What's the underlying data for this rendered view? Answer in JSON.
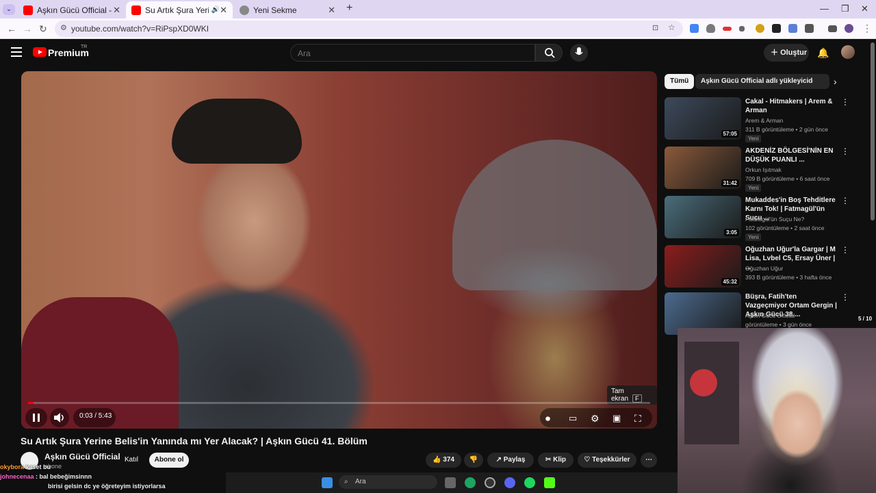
{
  "browser": {
    "tabs": [
      {
        "title": "Aşkın Gücü Official - YouTube"
      },
      {
        "title": "Su Artık Şura Yerine Belis'in"
      },
      {
        "title": "Yeni Sekme"
      }
    ],
    "url": "youtube.com/watch?v=RiPspXD0WKI"
  },
  "youtube": {
    "brand": "Premium",
    "region": "TR",
    "search_placeholder": "Ara",
    "create_label": "Oluştur"
  },
  "video": {
    "tooltip": "Tam ekran",
    "tooltip_key": "F",
    "timecode": "0:03 / 5:43",
    "progress": 0.009,
    "title": "Su Artık Şura Yerine Belis'in Yanında mı Yer Alacak? | Aşkın Gücü 41. Bölüm"
  },
  "channel": {
    "name": "Aşkın Gücü Official",
    "subs": "abone",
    "join_label": "Katıl",
    "subscribe_label": "Abone ol"
  },
  "actions": {
    "likes": "374",
    "share": "Paylaş",
    "clip": "Klip",
    "thanks": "Teşekkürler"
  },
  "chips": [
    "Tümü",
    "Aşkın Gücü Official adlı yükleyiciden"
  ],
  "recommendations": [
    {
      "title": "Cakal - Hitmakers | Arem & Arman",
      "channel": "Arem & Arman",
      "meta": "311 B görüntüleme • 2 gün önce",
      "badge": "Yeni",
      "duration": "57:05",
      "color": "#3d4a5c"
    },
    {
      "title": "AKDENİZ BÖLGESİ'NİN EN DÜŞÜK PUANLI ...",
      "channel": "Orkun Işıtmak",
      "meta": "709 B görüntüleme • 6 saat önce",
      "badge": "Yeni",
      "duration": "31:42",
      "color": "#8a5a3a"
    },
    {
      "title": "Mukaddes'in Boş Tehditlere Karnı Tok! | Fatmagül'ün Suçu ...",
      "channel": "Fatmagül'ün Suçu Ne?",
      "meta": "102 görüntüleme • 2 saat önce",
      "badge": "Yeni",
      "duration": "3:05",
      "color": "#4a6d7a"
    },
    {
      "title": "Oğuzhan Uğur'la Gargar | M Lisa, Lvbel C5, Ersay Üner | ...",
      "channel": "Oğuzhan Uğur",
      "meta": "393 B görüntüleme • 3 hafta önce",
      "badge": "",
      "duration": "45:32",
      "color": "#8c1d1d"
    },
    {
      "title": "Büşra, Fatih'ten Vazgeçmiyor Ortam Gergin | Aşkın Gücü 38....",
      "channel": "Aşkın Gücü Official",
      "meta": "görüntüleme • 3 gün önce",
      "badge": "",
      "duration": "",
      "color": "#4c6b8f"
    }
  ],
  "pager": "5 / 10",
  "chat": [
    {
      "user": "okybora",
      "text": "kaset bu"
    },
    {
      "user": "johnecenaa",
      "text": "bal bebeğimsinnn"
    },
    {
      "user": "",
      "text": "birisi gelsin dc ye öğreteyim istiyorlarsa"
    }
  ],
  "taskbar": {
    "search": "Ara"
  }
}
